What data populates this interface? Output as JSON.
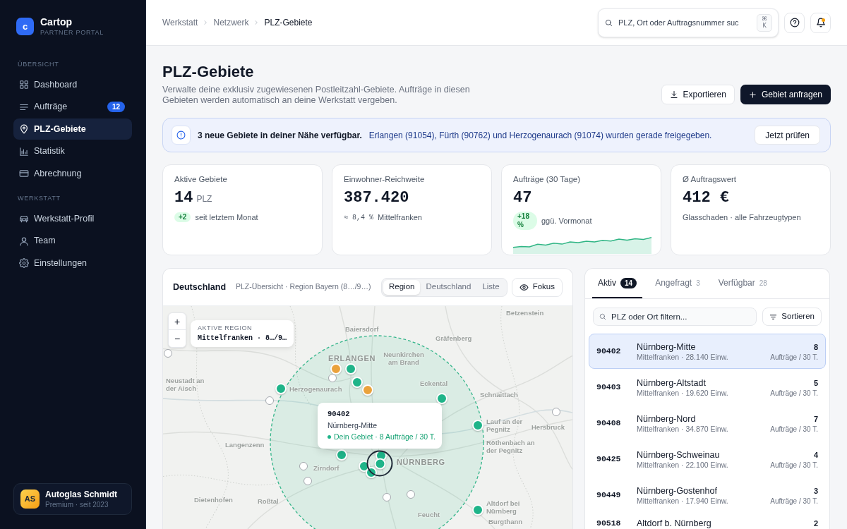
{
  "sidebar": {
    "brand": {
      "logo_letter": "c",
      "name": "Cartop",
      "tagline": "PARTNER PORTAL"
    },
    "sections": [
      {
        "heading": "ÜBERSICHT",
        "items": [
          {
            "label": "Dashboard",
            "selected": false
          },
          {
            "label": "Aufträge",
            "badge": "12",
            "selected": false
          },
          {
            "label": "PLZ-Gebiete",
            "selected": true
          },
          {
            "label": "Statistik",
            "selected": false
          },
          {
            "label": "Abrechnung",
            "selected": false
          }
        ]
      },
      {
        "heading": "WERKSTATT",
        "items": [
          {
            "label": "Werkstatt-Profil",
            "selected": false
          },
          {
            "label": "Team",
            "selected": false
          },
          {
            "label": "Einstellungen",
            "selected": false
          }
        ]
      }
    ],
    "account": {
      "initials": "AS",
      "name": "Autoglas Schmidt",
      "plan": "Premium · seit 2023"
    }
  },
  "topbar": {
    "breadcrumb": [
      "Werkstatt",
      "Netzwerk",
      "PLZ-Gebiete"
    ],
    "search": {
      "placeholder": "PLZ, Ort oder Auftragsnummer suc",
      "shortcut": "⌘ K"
    },
    "notifications": {
      "unread": true
    }
  },
  "header": {
    "title": "PLZ-Gebiete",
    "description": "Verwalte deine exklusiv zugewiesenen Postleitzahl-Gebiete. Aufträge in diesen Gebieten werden automatisch an deine Werkstatt vergeben.",
    "buttons": [
      {
        "label": "Exportieren",
        "kind": "secondary"
      },
      {
        "label": "Gebiet anfragen",
        "kind": "primary"
      }
    ]
  },
  "banner": {
    "title": "3 neue Gebiete in deiner Nähe verfügbar.",
    "message": "Erlangen (91054), Fürth (90762) und Herzogenaurach (91074) wurden gerade freigegeben.",
    "action": "Jetzt prüfen"
  },
  "stats": [
    {
      "label": "Aktive Gebiete",
      "value": "14",
      "unit": "PLZ",
      "badge": "+2",
      "note": "seit letztem Monat",
      "sparkline": false
    },
    {
      "label": "Einwohner-Reichweite",
      "value": "387.420",
      "reading": "≈ 8,4 %",
      "note": "Mittelfranken",
      "sparkline": false
    },
    {
      "label": "Aufträge (30 Tage)",
      "value": "47",
      "badge": "+18 %",
      "note": "ggü. Vormonat",
      "sparkline": true
    },
    {
      "label": "Ø Auftragswert",
      "value": "412 €",
      "note": "Glasschaden · alle Fahrzeugtypen",
      "sparkline": false
    }
  ],
  "map": {
    "title": "Deutschland",
    "subtitle": "PLZ-Übersicht · Region Bayern (8…/9…)",
    "views": [
      {
        "label": "Region",
        "selected": true
      },
      {
        "label": "Deutschland",
        "selected": false
      },
      {
        "label": "Liste",
        "selected": false
      }
    ],
    "focus_button": "Fokus",
    "zoom_in": "+",
    "zoom_out": "−",
    "region_card": {
      "heading": "AKTIVE REGION",
      "value": "Mittelfranken · 8…/9…"
    },
    "place_labels": [
      {
        "text": "Betzenstein",
        "kind": "town"
      },
      {
        "text": "Baiersdorf",
        "kind": "town"
      },
      {
        "text": "Gräfenberg",
        "kind": "town"
      },
      {
        "text": "ERLANGEN",
        "kind": "city"
      },
      {
        "text": "Neunkirchen am Brand",
        "kind": "town"
      },
      {
        "text": "Neustadt an der Aisch",
        "kind": "town"
      },
      {
        "text": "Herzogenaurach",
        "kind": "town"
      },
      {
        "text": "Eckental",
        "kind": "town"
      },
      {
        "text": "Schnaittach",
        "kind": "town"
      },
      {
        "text": "Lauf an der Pegnitz",
        "kind": "town"
      },
      {
        "text": "Hersbruck",
        "kind": "town"
      },
      {
        "text": "Langenzenn",
        "kind": "town"
      },
      {
        "text": "Röthenbach an der Pegnitz",
        "kind": "town"
      },
      {
        "text": "Zirndorf",
        "kind": "town"
      },
      {
        "text": "NÜRNBERG",
        "kind": "city"
      },
      {
        "text": "Dietenhofen",
        "kind": "town"
      },
      {
        "text": "Roßtal",
        "kind": "town"
      },
      {
        "text": "Feucht",
        "kind": "town"
      },
      {
        "text": "Altdorf bei Nürnberg",
        "kind": "town"
      },
      {
        "text": "Burgthann",
        "kind": "town"
      }
    ],
    "markers": [
      {
        "kind": "available",
        "selected": false
      },
      {
        "kind": "requested",
        "selected": false
      },
      {
        "kind": "active",
        "selected": false
      },
      {
        "kind": "available",
        "selected": false
      },
      {
        "kind": "active",
        "selected": false
      },
      {
        "kind": "active",
        "selected": false
      },
      {
        "kind": "requested",
        "selected": false
      },
      {
        "kind": "active",
        "selected": false
      },
      {
        "kind": "available",
        "selected": false
      },
      {
        "kind": "available",
        "selected": false
      },
      {
        "kind": "active",
        "selected": false
      },
      {
        "kind": "active",
        "selected": false
      },
      {
        "kind": "active",
        "selected": false
      },
      {
        "kind": "active",
        "selected": true
      },
      {
        "kind": "active",
        "selected": false
      },
      {
        "kind": "available",
        "selected": false
      },
      {
        "kind": "active",
        "selected": false
      },
      {
        "kind": "available",
        "selected": false
      },
      {
        "kind": "available",
        "selected": false
      },
      {
        "kind": "available",
        "selected": false
      },
      {
        "kind": "active",
        "selected": false
      }
    ],
    "tooltip": {
      "plz": "90402",
      "name": "Nürnberg-Mitte",
      "status": "Dein Gebiet · 8 Aufträge / 30 T."
    }
  },
  "areas": {
    "tabs": [
      {
        "label": "Aktiv",
        "count": "14",
        "selected": true
      },
      {
        "label": "Angefragt",
        "count": "3",
        "selected": false
      },
      {
        "label": "Verfügbar",
        "count": "28",
        "selected": false
      }
    ],
    "filter": {
      "placeholder": "PLZ oder Ort filtern..."
    },
    "sort_button": "Sortieren",
    "rows": [
      {
        "plz": "90402",
        "name": "Nürnberg-Mitte",
        "details": "Mittelfranken · 28.140 Einw.",
        "count": "8",
        "count_label": "Aufträge / 30 T.",
        "selected": true
      },
      {
        "plz": "90403",
        "name": "Nürnberg-Altstadt",
        "details": "Mittelfranken · 19.620 Einw.",
        "count": "5",
        "count_label": "Aufträge / 30 T.",
        "selected": false
      },
      {
        "plz": "90408",
        "name": "Nürnberg-Nord",
        "details": "Mittelfranken · 34.870 Einw.",
        "count": "7",
        "count_label": "Aufträge / 30 T.",
        "selected": false
      },
      {
        "plz": "90425",
        "name": "Nürnberg-Schweinau",
        "details": "Mittelfranken · 22.100 Einw.",
        "count": "4",
        "count_label": "Aufträge / 30 T.",
        "selected": false
      },
      {
        "plz": "90449",
        "name": "Nürnberg-Gostenhof",
        "details": "Mittelfranken · 17.940 Einw.",
        "count": "3",
        "count_label": "Aufträge / 30 T.",
        "selected": false
      },
      {
        "plz": "90518",
        "name": "Altdorf b. Nürnberg",
        "count": "2",
        "selected": false
      }
    ]
  }
}
